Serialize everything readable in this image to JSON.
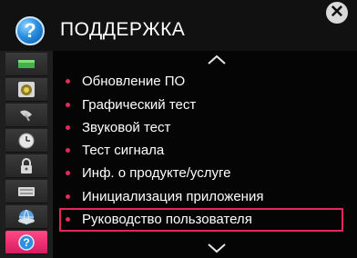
{
  "header": {
    "title": "ПОДДЕРЖКА",
    "help_badge": "?",
    "close_glyph": "✕"
  },
  "rail": [
    {
      "icon": "picture-icon",
      "color": "#3fb24a"
    },
    {
      "icon": "speaker-icon",
      "color": "#c9b13a"
    },
    {
      "icon": "satellite-dish-icon",
      "color": "#d0d0d0"
    },
    {
      "icon": "clock-icon",
      "color": "#d8d8d8"
    },
    {
      "icon": "lock-icon",
      "color": "#d8d8d8"
    },
    {
      "icon": "keyboard-icon",
      "color": "#d8d8d8"
    },
    {
      "icon": "network-globe-icon",
      "color": "#5aa0e0"
    },
    {
      "icon": "support-icon",
      "color": "#ffffff",
      "selected": true,
      "glyph": "?"
    }
  ],
  "menu": {
    "scroll_up": "chevron-up-icon",
    "scroll_down": "chevron-down-icon",
    "items": [
      {
        "label": "Обновление ПО"
      },
      {
        "label": "Графический тест"
      },
      {
        "label": "Звуковой тест"
      },
      {
        "label": "Тест сигнала"
      },
      {
        "label": "Инф. о продукте/услуге"
      },
      {
        "label": "Инициализация приложения"
      },
      {
        "label": "Руководство пользователя",
        "highlighted": true
      }
    ]
  },
  "colors": {
    "accent": "#e0285e",
    "bg": "#050505",
    "text": "#ffffff"
  }
}
